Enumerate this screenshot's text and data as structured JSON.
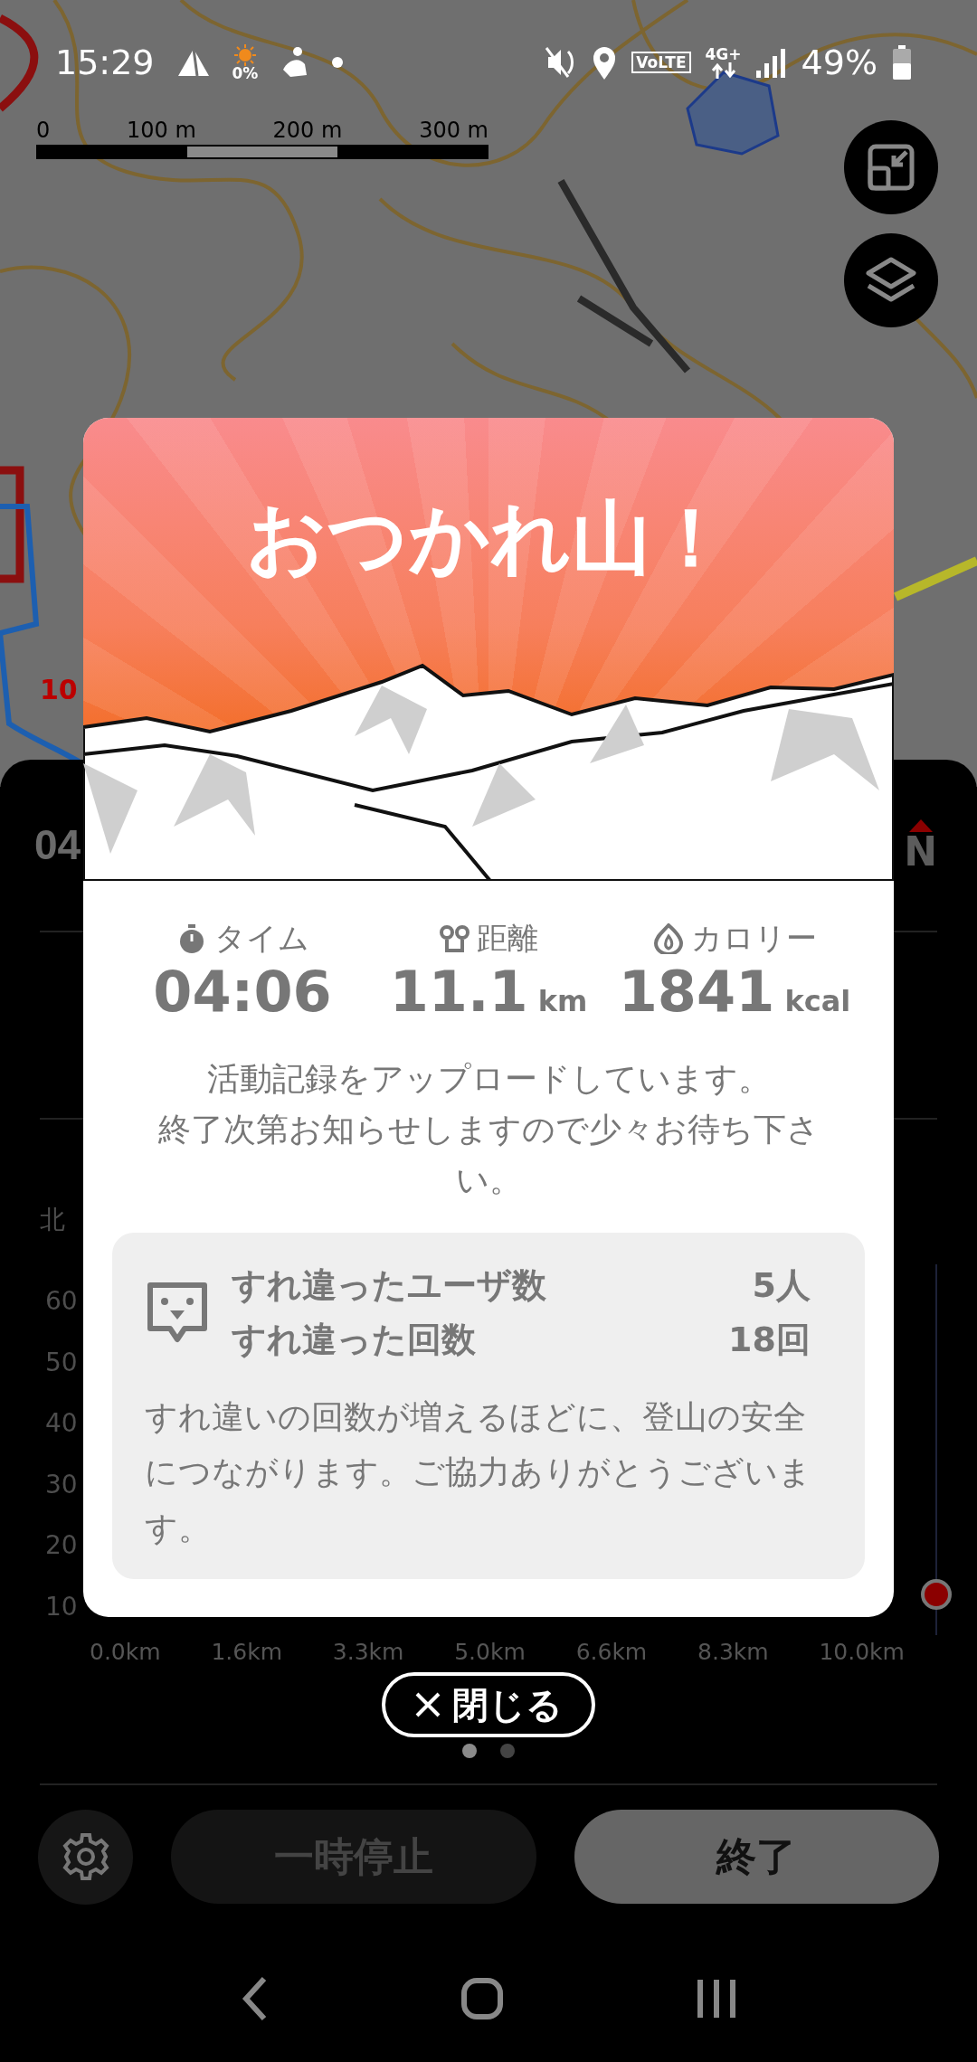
{
  "status_bar": {
    "time": "15:29",
    "weather_reading": "0%",
    "volte": "VoLTE",
    "network": "4G+",
    "battery": "49%"
  },
  "map": {
    "scale_labels": [
      "0",
      "100 m",
      "200 m",
      "300 m"
    ],
    "route_label": "10"
  },
  "activity_sheet": {
    "elapsed_partial": "04",
    "compass": "N",
    "direction_partial": "北",
    "y_labels": [
      "60",
      "50",
      "40",
      "30",
      "20",
      "10"
    ],
    "x_labels": [
      "0.0km",
      "1.6km",
      "3.3km",
      "5.0km",
      "6.6km",
      "8.3km",
      "10.0km"
    ],
    "page_dots": [
      {
        "selected": true
      },
      {
        "selected": false
      }
    ],
    "buttons": [
      {
        "kind": "settings"
      },
      {
        "kind": "pause",
        "label": "一時停止"
      },
      {
        "kind": "finish",
        "label": "終了"
      }
    ]
  },
  "dialog": {
    "title": "おつかれ山！",
    "stats": [
      {
        "kind": "time",
        "label": "タイム",
        "value": "04:06"
      },
      {
        "kind": "distance",
        "label": "距離",
        "value": "11.1",
        "unit": "km"
      },
      {
        "kind": "calories",
        "label": "カロリー",
        "value": "1841",
        "unit": "kcal"
      }
    ],
    "message_lines": [
      "活動記録をアップロードしています。",
      "終了次第お知らせしますので少々お待ち下さい。"
    ],
    "encounters": {
      "rows": [
        {
          "label": "すれ違ったユーザ数",
          "value": "5人"
        },
        {
          "label": "すれ違った回数",
          "value": "18回"
        }
      ],
      "note": "すれ違いの回数が増えるほどに、登山の安全につながります。ご協力ありがとうございます。"
    }
  },
  "close_button": "閉じる"
}
